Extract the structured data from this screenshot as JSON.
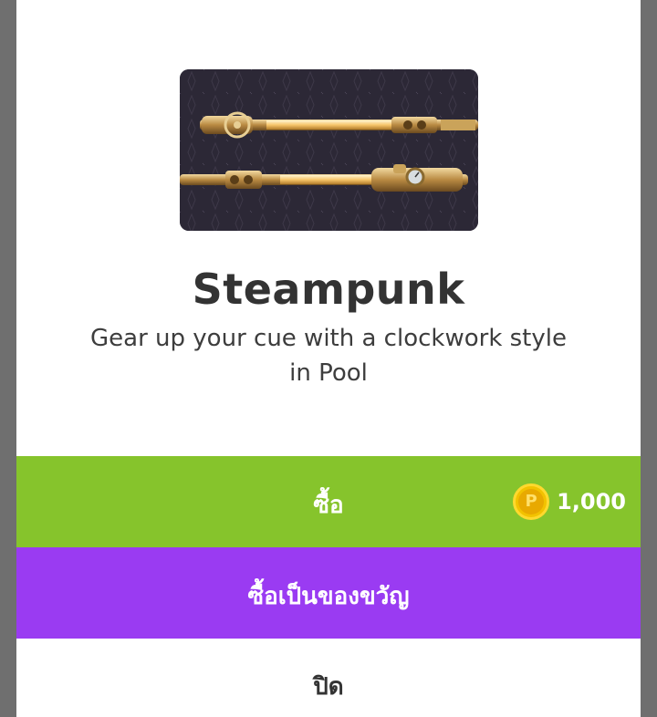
{
  "item": {
    "name": "Steampunk",
    "description": "Gear up your cue with a clockwork style in Pool",
    "image_icon": "cue-stick-icon"
  },
  "buttons": {
    "buy_label": "ซื้อ",
    "gift_label": "ซื้อเป็นของขวัญ",
    "close_label": "ปิด"
  },
  "price": {
    "amount": "1,000",
    "currency_icon": "coin-icon",
    "coin_letter": "P"
  },
  "colors": {
    "buy": "#86c42c",
    "gift": "#9a3bf2",
    "close": "#ffffff",
    "coin": "#f2c200"
  }
}
